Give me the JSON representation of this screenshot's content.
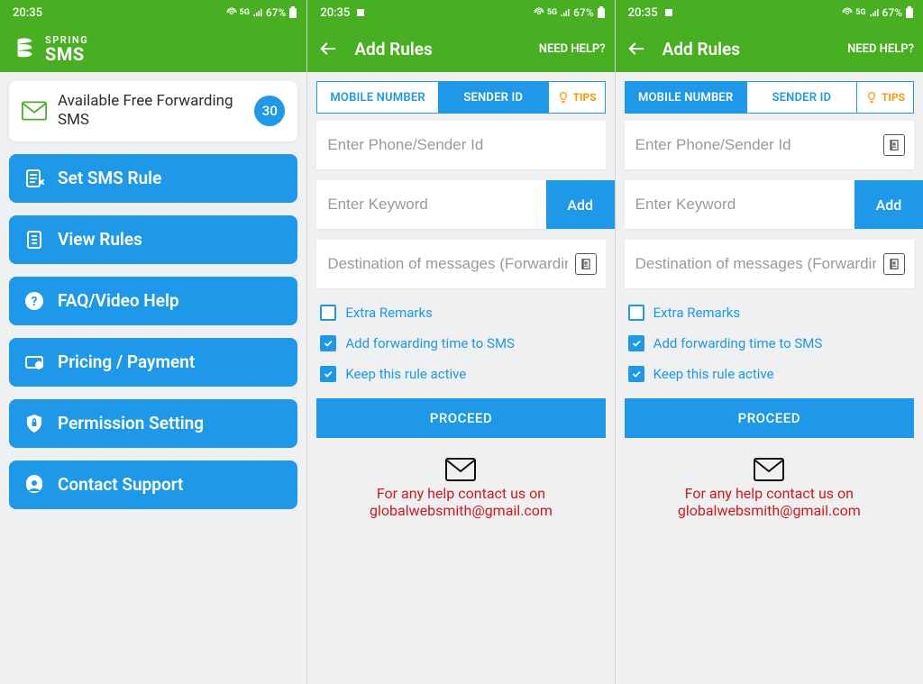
{
  "status": {
    "time": "20:35",
    "battery": "67%"
  },
  "brand": {
    "spring": "SPRING",
    "sms": "SMS"
  },
  "s1": {
    "card_label": "Available Free Forwarding SMS",
    "card_count": "30",
    "menu": [
      "Set SMS Rule",
      "View Rules",
      "FAQ/Video Help",
      "Pricing / Payment",
      "Permission Setting",
      "Contact Support"
    ]
  },
  "rules": {
    "title": "Add Rules",
    "help": "NEED HELP?",
    "tabs": {
      "mobile": "MOBILE NUMBER",
      "sender": "SENDER ID",
      "tips": "TIPS"
    },
    "ph_phone": "Enter Phone/Sender Id",
    "ph_keyword": "Enter Keyword",
    "add": "Add",
    "ph_dest": "Destination of messages (Forwardin…",
    "chk_extra": "Extra Remarks",
    "chk_time": "Add forwarding time to SMS",
    "chk_active": "Keep this rule active",
    "proceed": "PROCEED",
    "help_line1": "For any help contact us on",
    "help_line2": "globalwebsmith@gmail.com"
  }
}
